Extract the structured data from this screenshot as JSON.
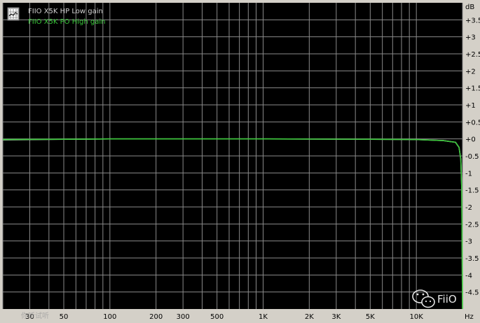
{
  "legend": {
    "entries": [
      {
        "label": "FIIO X5K HP Low gain",
        "color": "#d0d0d0"
      },
      {
        "label": "FIIO X5K PO High gain",
        "color": "#39c739"
      }
    ],
    "icon": "graph-icon"
  },
  "watermark": {
    "left_text": "你听试听",
    "right_text": "FiiO",
    "icon": "wechat-icon"
  },
  "colors": {
    "plot_bg": "#000000",
    "grid": "#8a8a8a",
    "frame_bg": "#d4d0c8",
    "series_low": "#d0d0d0",
    "series_high": "#39c739"
  },
  "chart_data": {
    "type": "line",
    "title": "",
    "xlabel": "Hz",
    "ylabel": "dB",
    "x_scale": "log",
    "xlim": [
      20,
      20000
    ],
    "ylim": [
      -5,
      4
    ],
    "grid": true,
    "legend_position": "top-left",
    "y_ticks": [
      {
        "value": 3.5,
        "label": "+3.5"
      },
      {
        "value": 3,
        "label": "+3"
      },
      {
        "value": 2.5,
        "label": "+2.5"
      },
      {
        "value": 2,
        "label": "+2"
      },
      {
        "value": 1.5,
        "label": "+1.5"
      },
      {
        "value": 1,
        "label": "+1"
      },
      {
        "value": 0.5,
        "label": "+0.5"
      },
      {
        "value": 0,
        "label": "+0"
      },
      {
        "value": -0.5,
        "label": "-0.5"
      },
      {
        "value": -1,
        "label": "-1"
      },
      {
        "value": -1.5,
        "label": "-1.5"
      },
      {
        "value": -2,
        "label": "-2"
      },
      {
        "value": -2.5,
        "label": "-2.5"
      },
      {
        "value": -3,
        "label": "-3"
      },
      {
        "value": -3.5,
        "label": "-3.5"
      },
      {
        "value": -4,
        "label": "-4"
      },
      {
        "value": -4.5,
        "label": "-4.5"
      }
    ],
    "x_ticks": [
      {
        "value": 30,
        "label": "30"
      },
      {
        "value": 50,
        "label": "50"
      },
      {
        "value": 100,
        "label": "100"
      },
      {
        "value": 200,
        "label": "200"
      },
      {
        "value": 300,
        "label": "300"
      },
      {
        "value": 500,
        "label": "500"
      },
      {
        "value": 1000,
        "label": "1K"
      },
      {
        "value": 2000,
        "label": "2K"
      },
      {
        "value": 3000,
        "label": "3K"
      },
      {
        "value": 5000,
        "label": "5K"
      },
      {
        "value": 10000,
        "label": "10K"
      }
    ],
    "x_minor": [
      20,
      30,
      40,
      50,
      60,
      70,
      80,
      90,
      100,
      200,
      300,
      400,
      500,
      600,
      700,
      800,
      900,
      1000,
      2000,
      3000,
      4000,
      5000,
      6000,
      7000,
      8000,
      9000,
      10000,
      20000
    ],
    "series": [
      {
        "name": "FIIO X5K HP Low gain",
        "color": "#d0d0d0",
        "points": [
          [
            20,
            -0.03
          ],
          [
            50,
            -0.01
          ],
          [
            100,
            0
          ],
          [
            1000,
            0
          ],
          [
            5000,
            -0.01
          ],
          [
            10000,
            -0.02
          ],
          [
            15000,
            -0.05
          ],
          [
            18000,
            -0.1
          ],
          [
            19000,
            -0.25
          ],
          [
            19500,
            -0.6
          ],
          [
            19800,
            -1.5
          ],
          [
            20000,
            -5
          ]
        ]
      },
      {
        "name": "FIIO X5K PO High gain",
        "color": "#39c739",
        "points": [
          [
            20,
            -0.02
          ],
          [
            50,
            -0.01
          ],
          [
            100,
            0
          ],
          [
            1000,
            0
          ],
          [
            5000,
            -0.01
          ],
          [
            10000,
            -0.02
          ],
          [
            15000,
            -0.05
          ],
          [
            18000,
            -0.1
          ],
          [
            19000,
            -0.25
          ],
          [
            19500,
            -0.6
          ],
          [
            19800,
            -1.5
          ],
          [
            20000,
            -5
          ]
        ]
      }
    ]
  }
}
